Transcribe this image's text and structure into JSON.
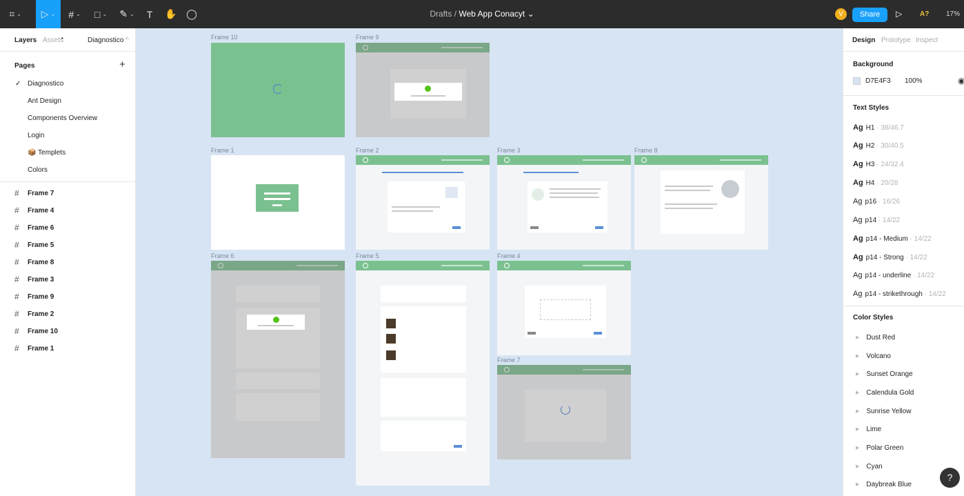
{
  "toolbar": {
    "tools": [
      {
        "name": "figma-menu-icon",
        "glyph": "⌗"
      },
      {
        "name": "move-tool-icon",
        "glyph": "▷"
      },
      {
        "name": "frame-tool-icon",
        "glyph": "#"
      },
      {
        "name": "shape-tool-icon",
        "glyph": "□"
      },
      {
        "name": "pen-tool-icon",
        "glyph": "✎"
      },
      {
        "name": "text-tool-icon",
        "glyph": "T"
      },
      {
        "name": "hand-tool-icon",
        "glyph": "✋"
      },
      {
        "name": "comment-tool-icon",
        "glyph": "◯"
      }
    ],
    "title_prefix": "Drafts",
    "title_sep": "/",
    "file_name": "Web App Conacyt",
    "file_caret": "⌄",
    "avatar": "V",
    "share_label": "Share",
    "play_icon": "▷",
    "a7": "A?",
    "zoom": "17%"
  },
  "left_panel": {
    "tabs": {
      "layers": "Layers",
      "assets": "Assets",
      "page": "Diagnostico"
    },
    "pages_title": "Pages",
    "add_icon": "+",
    "pages": [
      {
        "label": "Diagnostico",
        "active": true
      },
      {
        "label": "Ant Design",
        "active": false
      },
      {
        "label": "Components Overview",
        "active": false
      },
      {
        "label": "Login",
        "active": false
      },
      {
        "label": "📦 Templets",
        "active": false
      },
      {
        "label": "Colors",
        "active": false
      }
    ],
    "layers": [
      "Frame 7",
      "Frame 4",
      "Frame 6",
      "Frame 5",
      "Frame 8",
      "Frame 3",
      "Frame 9",
      "Frame 2",
      "Frame 10",
      "Frame 1"
    ]
  },
  "right_panel": {
    "tabs": {
      "design": "Design",
      "prototype": "Prototype",
      "inspect": "Inspect"
    },
    "background_title": "Background",
    "bg_hex": "D7E4F3",
    "bg_opacity": "100%",
    "bg_color": "#d7e4f3",
    "text_styles_title": "Text Styles",
    "text_styles": [
      {
        "ag": "Ag",
        "name": "H1",
        "meta": " · 38/46.7"
      },
      {
        "ag": "Ag",
        "name": "H2",
        "meta": " · 30/40.5"
      },
      {
        "ag": "Ag",
        "name": "H3",
        "meta": " · 24/32.4"
      },
      {
        "ag": "Ag",
        "name": "H4",
        "meta": " · 20/28"
      },
      {
        "ag": "Ag",
        "name": "p16",
        "meta": " · 16/26"
      },
      {
        "ag": "Ag",
        "name": "p14",
        "meta": " · 14/22"
      },
      {
        "ag": "Ag",
        "name": "p14 - Medium",
        "meta": " · 14/22"
      },
      {
        "ag": "Ag",
        "name": "p14 - Strong",
        "meta": " · 14/22"
      },
      {
        "ag": "Ag",
        "name": "p14 - underline",
        "meta": " · 14/22"
      },
      {
        "ag": "Ag",
        "name": "p14 - strikethrough",
        "meta": " · 14/22"
      }
    ],
    "color_styles_title": "Color Styles",
    "color_styles": [
      "Dust Red",
      "Volcano",
      "Sunset Orange",
      "Calendula Gold",
      "Sunrise Yellow",
      "Lime",
      "Polar Green",
      "Cyan",
      "Daybreak Blue"
    ]
  },
  "canvas": {
    "frame_labels": {
      "f10": "Frame 10",
      "f9": "Frame 9",
      "f1": "Frame 1",
      "f2": "Frame 2",
      "f3": "Frame 3",
      "f8": "Frame 8",
      "f6": "Frame 6",
      "f5": "Frame 5",
      "f4": "Frame 4",
      "f7": "Frame 7"
    }
  },
  "colors": {
    "accent": "#18a0fb",
    "brand_green": "#7bc190",
    "canvas_bg": "#d7e4f3"
  },
  "help_icon": "?"
}
